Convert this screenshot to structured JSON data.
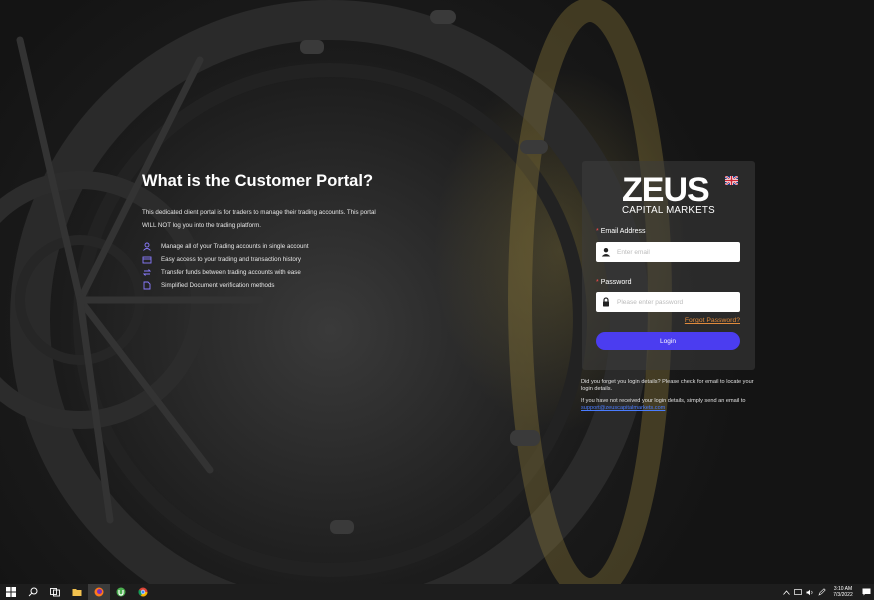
{
  "left": {
    "title": "What is the Customer Portal?",
    "description": "This dedicated client portal is for traders to manage their trading accounts. This portal WILL NOT log you into the trading platform.",
    "features": [
      {
        "icon": "user-icon",
        "label": "Manage all of your Trading accounts in single account"
      },
      {
        "icon": "history-icon",
        "label": "Easy access to your trading and transaction history"
      },
      {
        "icon": "transfer-icon",
        "label": "Transfer funds between trading accounts with ease"
      },
      {
        "icon": "document-icon",
        "label": "Simplified Document verification methods"
      }
    ]
  },
  "login": {
    "logo_name": "ZEUS",
    "logo_sub": "CAPITAL MARKETS",
    "language_icon": "uk-flag-icon",
    "email_label": "Email Address",
    "email_placeholder": "Enter email",
    "password_label": "Password",
    "password_placeholder": "Please enter password",
    "required_mark": "*",
    "forgot_label": "Forgot Password?",
    "login_button": "Login",
    "accent_color": "#4b3df0",
    "forgot_color": "#e08a3c"
  },
  "help": {
    "line1": "Did you forget you login details? Please check for email to locate your login details.",
    "line2_prefix": "If you have not received your login details, simply send an email to",
    "line2_email": "support@zeuscapitalmarkets.com"
  },
  "taskbar": {
    "items": [
      "windows-start-icon",
      "search-icon",
      "task-view-icon",
      "file-explorer-icon",
      "firefox-icon",
      "utorrent-icon",
      "chrome-icon"
    ],
    "time": "3:10 AM",
    "date": "7/3/2022"
  }
}
